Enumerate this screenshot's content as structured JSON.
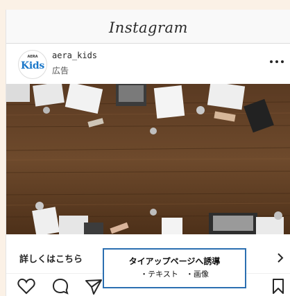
{
  "app": {
    "logo_text": "Instagram"
  },
  "post": {
    "username": "aera_kids",
    "sponsored_label": "広告",
    "avatar": {
      "brand_text": "Kids",
      "brand_color": "#1a77c9"
    }
  },
  "photo": {
    "icon": "desk-meeting-photo"
  },
  "cta": {
    "label": "詳しくはこちら",
    "chevron_icon": "chevron-right-icon"
  },
  "annotation": {
    "line1": "タイアップページへ誘導",
    "line2": "・テキスト　・画像",
    "border_color": "#2b6fb1"
  },
  "actions": {
    "like_icon": "heart-icon",
    "comment_icon": "comment-icon",
    "share_icon": "send-icon",
    "save_icon": "bookmark-icon"
  }
}
